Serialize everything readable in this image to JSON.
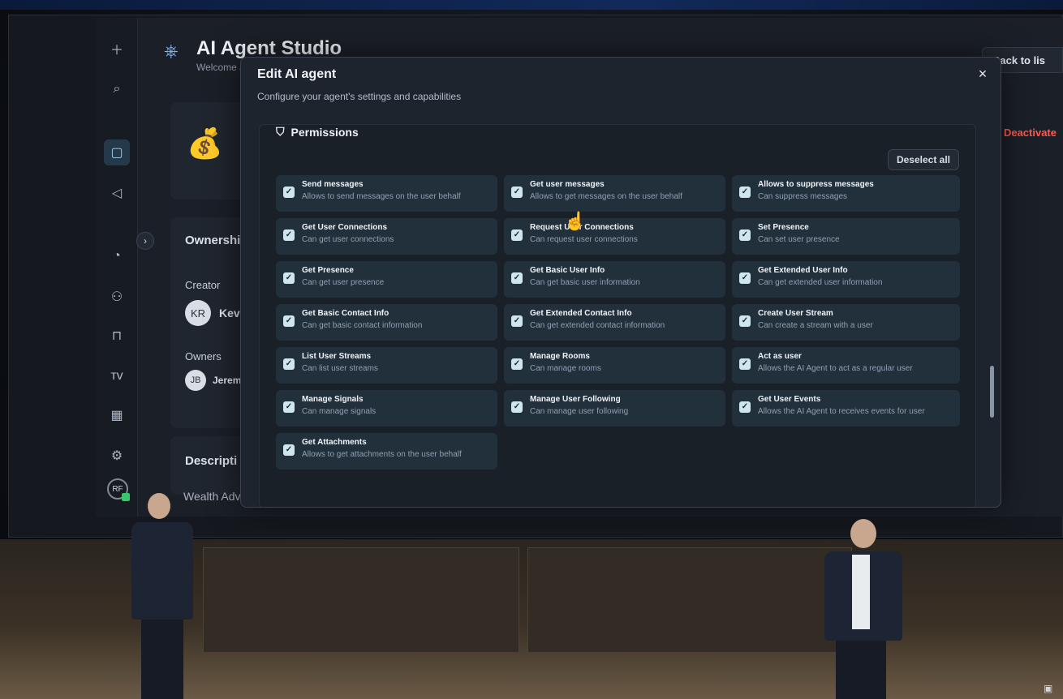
{
  "app": {
    "title": "AI Agent Studio",
    "welcome": "Welcome J",
    "back_label": "Back to lis",
    "deactivate_label": "Deactivate"
  },
  "sidebar": {
    "icons": [
      "plus-icon",
      "search-icon",
      "chat-icon",
      "megaphone-icon",
      "bell-icon",
      "users-icon",
      "bookmark-icon",
      "brand-icon",
      "apps-icon",
      "gear-icon"
    ],
    "avatar_initials": "RF"
  },
  "ownership": {
    "label": "Ownershi",
    "creator_label": "Creator",
    "creator_initials": "KR",
    "creator_name": "Kevin",
    "owners_label": "Owners",
    "owner_initials": "JB",
    "owner_name": "Jeremy I"
  },
  "description": {
    "label": "Descripti",
    "text": "Wealth Advisor agent"
  },
  "modal": {
    "title": "Edit AI agent",
    "subtitle": "Configure your agent's settings and capabilities",
    "close": "×",
    "permissions_title": "Permissions",
    "deselect_label": "Deselect all",
    "permissions": [
      {
        "title": "Send messages",
        "desc": "Allows to send messages on the user behalf"
      },
      {
        "title": "Get user messages",
        "desc": "Allows to get messages on the user behalf"
      },
      {
        "title": "Allows to suppress messages",
        "desc": "Can suppress messages"
      },
      {
        "title": "Get User Connections",
        "desc": "Can get user connections"
      },
      {
        "title": "Request User Connections",
        "desc": "Can request user connections"
      },
      {
        "title": "Set Presence",
        "desc": "Can set user presence"
      },
      {
        "title": "Get Presence",
        "desc": "Can get user presence"
      },
      {
        "title": "Get Basic User Info",
        "desc": "Can get basic user information"
      },
      {
        "title": "Get Extended User Info",
        "desc": "Can get extended user information"
      },
      {
        "title": "Get Basic Contact Info",
        "desc": "Can get basic contact information"
      },
      {
        "title": "Get Extended Contact Info",
        "desc": "Can get extended contact information"
      },
      {
        "title": "Create User Stream",
        "desc": "Can create a stream with a user"
      },
      {
        "title": "List User Streams",
        "desc": "Can list user streams"
      },
      {
        "title": "Manage Rooms",
        "desc": "Can manage rooms"
      },
      {
        "title": "Act as user",
        "desc": "Allows the AI Agent to act as a regular user"
      },
      {
        "title": "Manage Signals",
        "desc": "Can manage signals"
      },
      {
        "title": "Manage User Following",
        "desc": "Can manage user following"
      },
      {
        "title": "Get User Events",
        "desc": "Allows the AI Agent to receives events for user"
      },
      {
        "title": "Get Attachments",
        "desc": "Allows to get attachments on the user behalf"
      }
    ]
  }
}
